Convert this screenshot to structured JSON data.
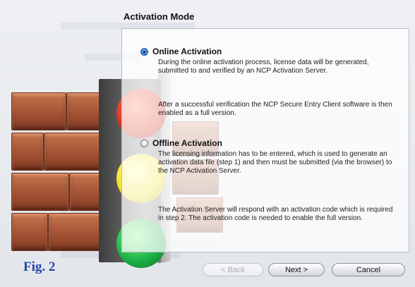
{
  "dialog": {
    "title": "Activation Mode"
  },
  "options": [
    {
      "label": "Online Activation",
      "selected": true,
      "paragraphs": [
        "During the online activation process, license data will be generated, submitted to and verified by an NCP Activation Server.",
        "After a successful verification the NCP Secure Entry Client software is then enabled as a full version."
      ]
    },
    {
      "label": "Offline Activation",
      "selected": false,
      "paragraphs": [
        "The licensing information has to be entered, which is used to generate an activation data file (step 1) and then must be submitted (via the browser) to the NCP Activation Server.",
        "The Activation Server will respond with an activation code which is required in step 2. The activation code is needed to enable the full version."
      ]
    }
  ],
  "buttons": {
    "back": "< Back",
    "next": "Next >",
    "cancel": "Cancel"
  },
  "figure_label": "Fig. 2",
  "colors": {
    "figure_label": "#2446a8",
    "radio_selected": "#2a6fd1",
    "lamp_red": "#d92f1c",
    "lamp_yellow": "#f1de22",
    "lamp_green": "#1db548"
  }
}
